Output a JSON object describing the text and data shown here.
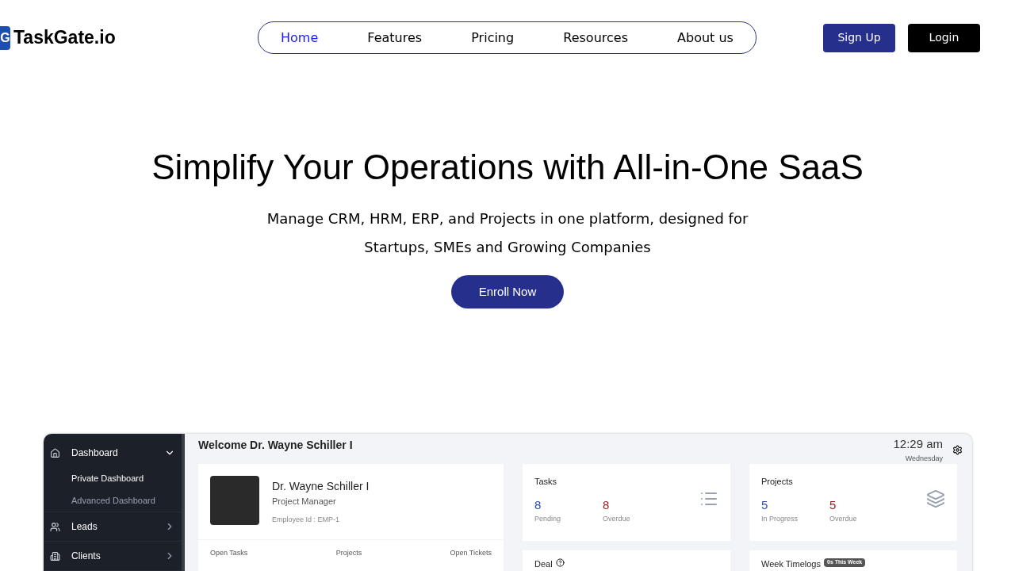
{
  "logo": {
    "mark": "G",
    "name": "TaskGate.io"
  },
  "nav": [
    {
      "label": "Home",
      "selected": true
    },
    {
      "label": "Features",
      "selected": false
    },
    {
      "label": "Pricing",
      "selected": false
    },
    {
      "label": "Resources",
      "selected": false
    },
    {
      "label": "About us",
      "selected": false
    }
  ],
  "auth_buttons": [
    {
      "label": "Sign Up",
      "kind": "primary"
    },
    {
      "label": "Login",
      "kind": "dark"
    }
  ],
  "hero": {
    "title": "Simplify Your Operations with All-in-One SaaS",
    "subtitle_lines": [
      "Manage CRM, HRM, ERP, and Projects in one platform, designed for",
      "Startups, SMEs and Growing Companies"
    ],
    "cta": "Enroll Now"
  },
  "dashboard": {
    "sidebar": [
      {
        "label": "Dashboard",
        "expanded": true,
        "children": [
          {
            "label": "Private Dashboard",
            "selected": true
          },
          {
            "label": "Advanced Dashboard",
            "selected": false
          }
        ]
      },
      {
        "label": "Leads",
        "expanded": false
      },
      {
        "label": "Clients",
        "expanded": false
      }
    ],
    "welcome": "Welcome Dr. Wayne Schiller I",
    "time": "12:29 am",
    "day": "Wednesday",
    "profile": {
      "name": "Dr. Wayne Schiller I",
      "role": "Project Manager",
      "employee_id": "Employee Id : EMP-1",
      "stats": [
        "Open Tasks",
        "Projects",
        "Open Tickets"
      ]
    },
    "cards": [
      {
        "title": "Tasks",
        "metrics": [
          {
            "value": "8",
            "label": "Pending",
            "color": "#2a4fb4"
          },
          {
            "value": "8",
            "label": "Overdue",
            "color": "#9b1c1c"
          }
        ]
      },
      {
        "title": "Projects",
        "metrics": [
          {
            "value": "5",
            "label": "In Progress",
            "color": "#2a4fb4"
          },
          {
            "value": "5",
            "label": "Overdue",
            "color": "#9b1c1c"
          }
        ]
      }
    ],
    "lower_cards": [
      {
        "title": "Deal",
        "help": true
      },
      {
        "title": "Week Timelogs",
        "badge": "0s This Week"
      }
    ]
  }
}
